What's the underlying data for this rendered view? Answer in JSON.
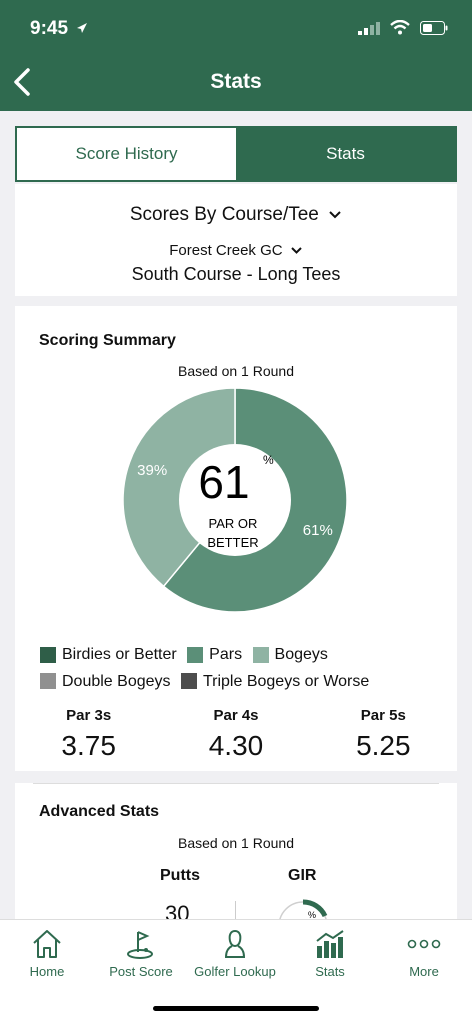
{
  "status_bar": {
    "time": "9:45"
  },
  "nav": {
    "title": "Stats"
  },
  "tabs": [
    {
      "label": "Score History",
      "active": false
    },
    {
      "label": "Stats",
      "active": true
    }
  ],
  "selector": {
    "title": "Scores By Course/Tee",
    "course": "Forest Creek GC",
    "tee": "South Course - Long Tees"
  },
  "scoring_summary": {
    "title": "Scoring Summary",
    "based_on": "Based on 1 Round",
    "center_value": "61",
    "center_unit": "%",
    "center_label_1": "PAR OR",
    "center_label_2": "BETTER",
    "legend": [
      {
        "label": "Birdies or Better",
        "color": "#2f5e48"
      },
      {
        "label": "Pars",
        "color": "#5b8f78"
      },
      {
        "label": "Bogeys",
        "color": "#8fb3a3"
      },
      {
        "label": "Double Bogeys",
        "color": "#909090"
      },
      {
        "label": "Triple Bogeys or Worse",
        "color": "#4d4d4d"
      }
    ],
    "par_averages": [
      {
        "label": "Par 3s",
        "value": "3.75"
      },
      {
        "label": "Par 4s",
        "value": "4.30"
      },
      {
        "label": "Par 5s",
        "value": "5.25"
      }
    ]
  },
  "chart_data": {
    "type": "pie",
    "categories": [
      "Pars",
      "Bogeys"
    ],
    "values": [
      61,
      39
    ],
    "labels": [
      "61%",
      "39%"
    ],
    "colors": [
      "#5b8f78",
      "#8fb3a3"
    ]
  },
  "advanced_stats": {
    "title": "Advanced Stats",
    "based_on": "Based on 1 Round",
    "putts_label": "Putts",
    "gir_label": "GIR",
    "gir_unit": "%",
    "putts_value_partial": "30"
  },
  "tabbar": [
    {
      "label": "Home",
      "icon": "home-icon"
    },
    {
      "label": "Post Score",
      "icon": "golf-flag-icon"
    },
    {
      "label": "Golfer Lookup",
      "icon": "person-icon"
    },
    {
      "label": "Stats",
      "icon": "bar-chart-icon"
    },
    {
      "label": "More",
      "icon": "more-dots-icon"
    }
  ],
  "colors": {
    "brand": "#2f6a4f"
  }
}
